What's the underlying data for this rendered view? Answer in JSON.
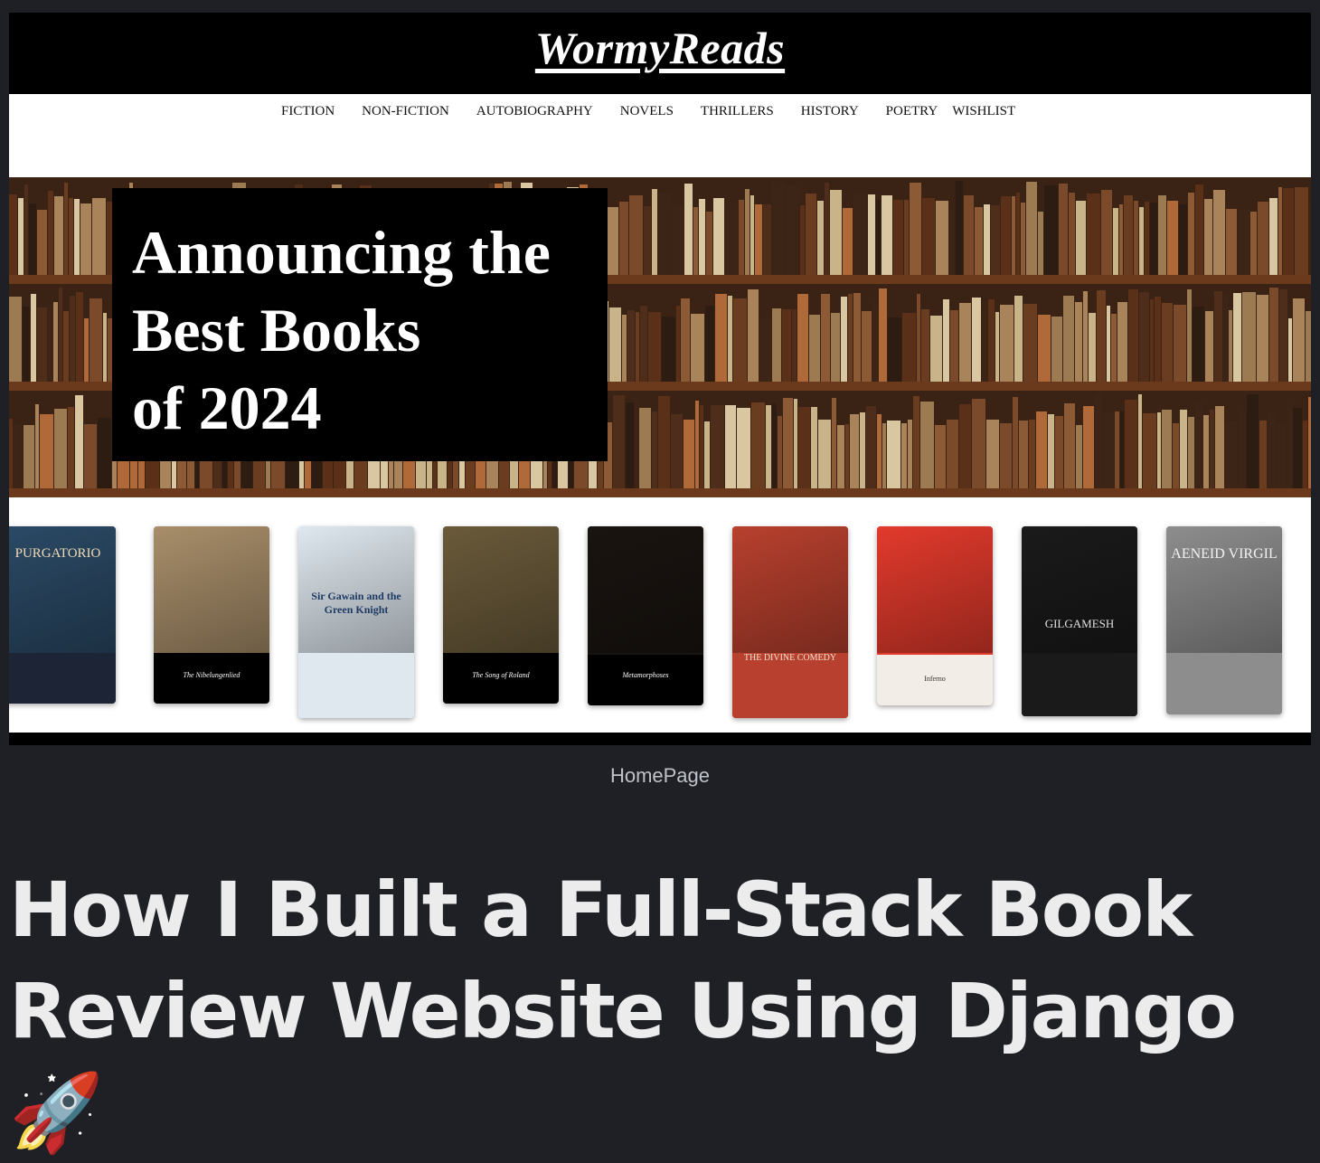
{
  "site": {
    "logo": "WormyReads",
    "nav": [
      "FICTION",
      "NON-FICTION",
      "AUTOBIOGRAPHY",
      "NOVELS",
      "THRILLERS",
      "HISTORY",
      "POETRY",
      "WISHLIST"
    ]
  },
  "hero": {
    "line1": "Announcing the",
    "line2": "Best Books",
    "line3": "of 2024"
  },
  "books": [
    {
      "title": "PURGATORIO",
      "colors": {
        "art": "#2b4a66",
        "label": "#1c2436"
      }
    },
    {
      "title": "The Nibelungenlied",
      "colors": {
        "art": "#a88e6a",
        "label": "#000000"
      }
    },
    {
      "title": "Sir Gawain and the Green Knight",
      "colors": {
        "art": "#dfe8ef",
        "label": "#dfe8ef"
      }
    },
    {
      "title": "The Song of Roland",
      "colors": {
        "art": "#6a5a3a",
        "label": "#000000"
      }
    },
    {
      "title": "Metamorphoses",
      "colors": {
        "art": "#1a1410",
        "label": "#000000"
      }
    },
    {
      "title": "THE DIVINE COMEDY",
      "colors": {
        "art": "#b8402e",
        "label": "#b8402e"
      }
    },
    {
      "title": "Inferno",
      "colors": {
        "art": "#e23a2c",
        "label": "#f2ede6"
      }
    },
    {
      "title": "GILGAMESH",
      "colors": {
        "art": "#1a1a1a",
        "label": "#1a1a1a"
      }
    },
    {
      "title": "AENEID VIRGIL",
      "colors": {
        "art": "#8d8d8d",
        "label": "#8d8d8d"
      }
    }
  ],
  "caption": "HomePage",
  "article": {
    "title_line1": "How I Built a Full-Stack Book",
    "title_line2": "Review Website Using Django🚀"
  }
}
